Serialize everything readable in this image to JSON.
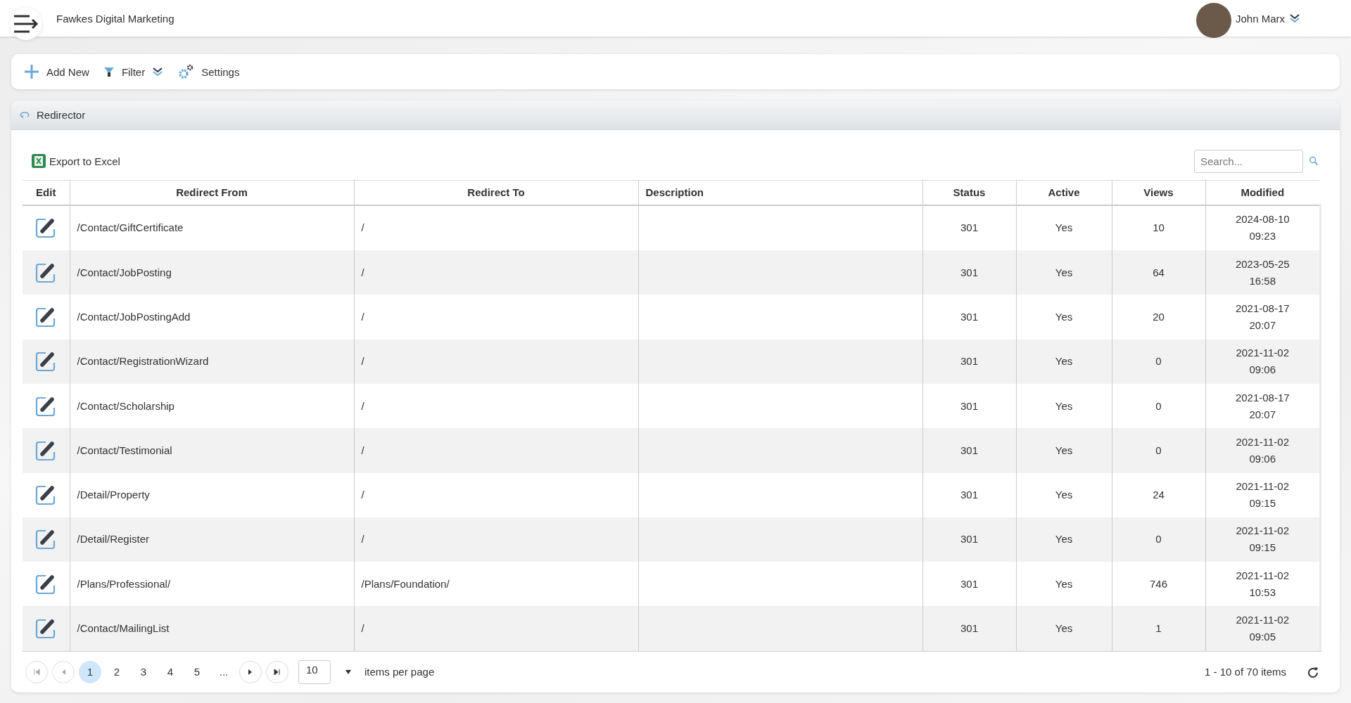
{
  "header": {
    "company": "Fawkes Digital Marketing",
    "user": "John Marx"
  },
  "toolbar": [
    {
      "kind": "add",
      "label": "Add New"
    },
    {
      "kind": "filter",
      "label": "Filter"
    },
    {
      "kind": "settings",
      "label": "Settings"
    }
  ],
  "panel": {
    "title": "Redirector",
    "export": "Export to Excel",
    "search": {
      "placeholder": "Search..."
    }
  },
  "table": {
    "columns": [
      "Edit",
      "Redirect From",
      "Redirect To",
      "Description",
      "Status",
      "Active",
      "Views",
      "Modified"
    ],
    "rows": [
      {
        "from": "/Contact/GiftCertificate",
        "to": "/",
        "status": "301",
        "active": "Yes",
        "views": "10",
        "date": "2024-08-10",
        "time": "09:23"
      },
      {
        "from": "/Contact/JobPosting",
        "to": "/",
        "status": "301",
        "active": "Yes",
        "views": "64",
        "date": "2023-05-25",
        "time": "16:58"
      },
      {
        "from": "/Contact/JobPostingAdd",
        "to": "/",
        "status": "301",
        "active": "Yes",
        "views": "20",
        "date": "2021-08-17",
        "time": "20:07"
      },
      {
        "from": "/Contact/RegistrationWizard",
        "to": "/",
        "status": "301",
        "active": "Yes",
        "views": "0",
        "date": "2021-11-02",
        "time": "09:06"
      },
      {
        "from": "/Contact/Scholarship",
        "to": "/",
        "status": "301",
        "active": "Yes",
        "views": "0",
        "date": "2021-08-17",
        "time": "20:07"
      },
      {
        "from": "/Contact/Testimonial",
        "to": "/",
        "status": "301",
        "active": "Yes",
        "views": "0",
        "date": "2021-11-02",
        "time": "09:06"
      },
      {
        "from": "/Detail/Property",
        "to": "/",
        "status": "301",
        "active": "Yes",
        "views": "24",
        "date": "2021-11-02",
        "time": "09:15"
      },
      {
        "from": "/Detail/Register",
        "to": "/",
        "status": "301",
        "active": "Yes",
        "views": "0",
        "date": "2021-11-02",
        "time": "09:15"
      },
      {
        "from": "/Plans/Professional/",
        "to": "/Plans/Foundation/",
        "status": "301",
        "active": "Yes",
        "views": "746",
        "date": "2021-11-02",
        "time": "10:53"
      },
      {
        "from": "/Contact/MailingList",
        "to": "/",
        "status": "301",
        "active": "Yes",
        "views": "1",
        "date": "2021-11-02",
        "time": "09:05"
      }
    ]
  },
  "pager": {
    "pages": [
      {
        "label": "1",
        "selected": true
      },
      {
        "label": "2",
        "selected": false
      },
      {
        "label": "3",
        "selected": false
      },
      {
        "label": "4",
        "selected": false
      },
      {
        "label": "5",
        "selected": false
      }
    ],
    "more": "...",
    "page_size": "10",
    "per_page_label": "items per page",
    "summary": "1 - 10 of 70 items"
  }
}
